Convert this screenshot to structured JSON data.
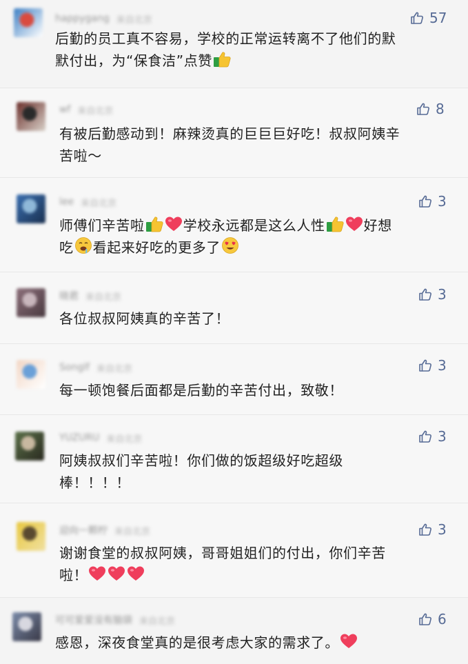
{
  "comments": [
    {
      "nickname": "happygang",
      "location": "来自北京",
      "likes": "57",
      "avatar_colors": [
        "#3c7fc4",
        "#d94b3f",
        "#ffffff"
      ],
      "lines": [
        [
          {
            "t": "后勤的员工真不容易，学校的正常运转离不了他们的默"
          }
        ],
        [
          {
            "t": "默付出，为“保食洁”点赞"
          },
          {
            "e": "thumbs-up-icon"
          }
        ]
      ]
    },
    {
      "nickname": "wf",
      "location": "来自北京",
      "likes": "8",
      "avatar_colors": [
        "#6b2f2b",
        "#2a2a2a",
        "#d8d0c8"
      ],
      "lines": [
        [
          {
            "t": "有被后勤感动到！麻辣烫真的巨巨巨好吃！叔叔阿姨辛"
          }
        ],
        [
          {
            "t": "苦啦～"
          }
        ]
      ]
    },
    {
      "nickname": "lee",
      "location": "来自北京",
      "likes": "3",
      "avatar_colors": [
        "#3a6fb0",
        "#8fb8d8",
        "#1a3050"
      ],
      "lines": [
        [
          {
            "t": "师傅们辛苦啦"
          },
          {
            "e": "thumbs-up-icon"
          },
          {
            "e": "heart-icon"
          },
          {
            "t": "学校永远都是这么人性"
          },
          {
            "e": "thumbs-up-icon"
          },
          {
            "e": "heart-icon"
          },
          {
            "t": "好想"
          }
        ],
        [
          {
            "t": "吃"
          },
          {
            "e": "drooling-face-icon"
          },
          {
            "t": "看起来好吃的更多了"
          },
          {
            "e": "heart-eyes-face-icon"
          }
        ]
      ]
    },
    {
      "nickname": "晓君",
      "location": "来自北京",
      "likes": "3",
      "avatar_colors": [
        "#8c6f7a",
        "#c8b6bc",
        "#4a3a40"
      ],
      "lines": [
        [
          {
            "t": "各位叔叔阿姨真的辛苦了！"
          }
        ]
      ]
    },
    {
      "nickname": "Songlf",
      "location": "来自北京",
      "likes": "3",
      "avatar_colors": [
        "#f2d6c4",
        "#6aa0d8",
        "#ffffff"
      ],
      "lines": [
        [
          {
            "t": "每一顿饱餐后面都是后勤的辛苦付出，致敬！"
          }
        ]
      ]
    },
    {
      "nickname": "YUZURU",
      "location": "来自北京",
      "likes": "3",
      "avatar_colors": [
        "#5a7048",
        "#c8b8a0",
        "#2a2a20"
      ],
      "lines": [
        [
          {
            "t": "阿姨叔叔们辛苦啦！你们做的饭超级好吃超级"
          }
        ],
        [
          {
            "t": "棒！！！！"
          }
        ]
      ]
    },
    {
      "nickname": "迎向一颗柠",
      "location": "来自北京",
      "likes": "3",
      "avatar_colors": [
        "#e8c840",
        "#5a4a30",
        "#f0e0a0"
      ],
      "lines": [
        [
          {
            "t": "谢谢食堂的叔叔阿姨，哥哥姐姐们的付出，你们辛苦"
          }
        ],
        [
          {
            "t": "啦！"
          },
          {
            "e": "heart-icon"
          },
          {
            "e": "heart-icon"
          },
          {
            "e": "heart-icon"
          }
        ]
      ]
    },
    {
      "nickname": "可可爱爱没有脑袋",
      "location": "来自北京",
      "likes": "6",
      "avatar_colors": [
        "#7a8aa8",
        "#d8d8e0",
        "#3a3a48"
      ],
      "lines": [
        [
          {
            "t": "感恩，深夜食堂真的是很考虑大家的需求了。"
          },
          {
            "e": "heart-icon"
          }
        ]
      ]
    }
  ]
}
